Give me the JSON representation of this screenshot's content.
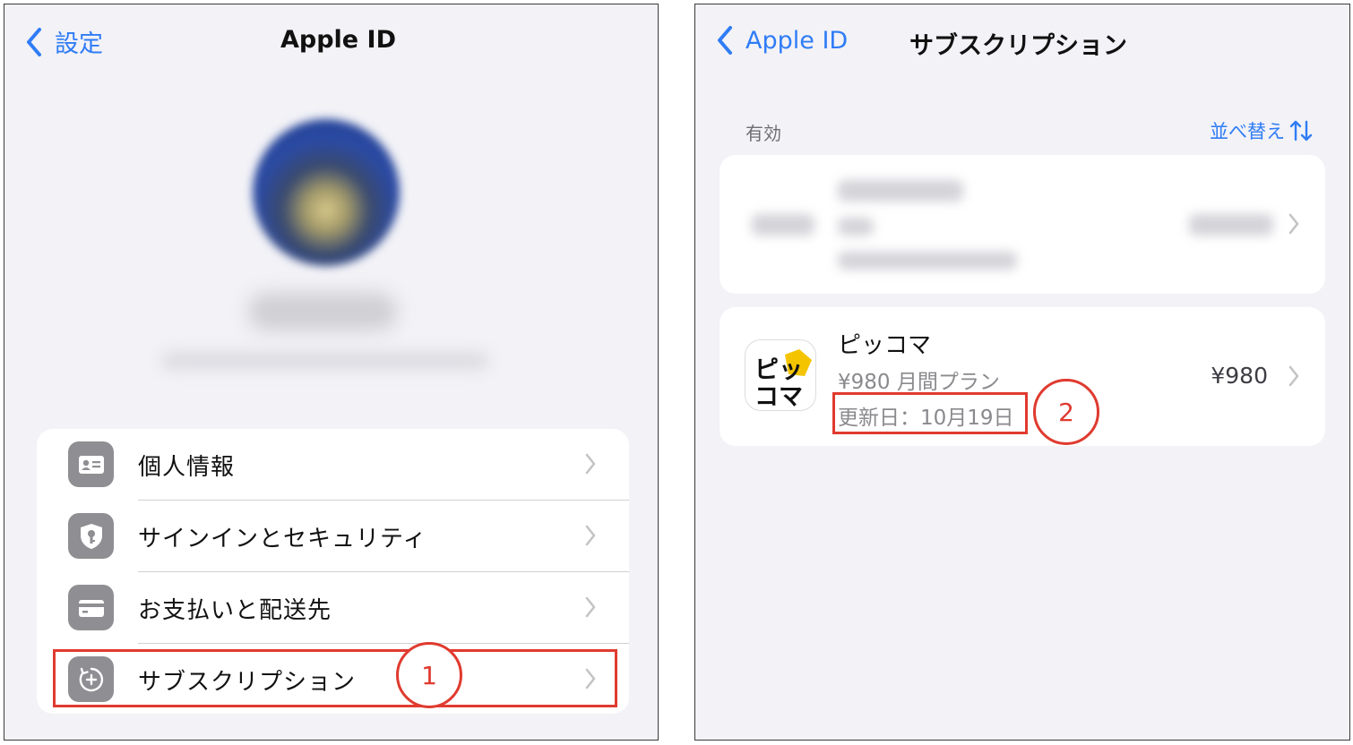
{
  "left": {
    "back_label": "設定",
    "title": "Apple ID",
    "menu": [
      {
        "label": "個人情報",
        "icon": "contact-card-icon"
      },
      {
        "label": "サインインとセキュリティ",
        "icon": "shield-key-icon"
      },
      {
        "label": "お支払いと配送先",
        "icon": "credit-card-icon"
      },
      {
        "label": "サブスクリプション",
        "icon": "subscription-plus-icon"
      }
    ],
    "callout": "1"
  },
  "right": {
    "back_label": "Apple ID",
    "title": "サブスクリプション",
    "section_header": "有効",
    "sort_label": "並べ替え",
    "subscription": {
      "name": "ピッコマ",
      "plan": "¥980 月間プラン",
      "renewal": "更新日：10月19日",
      "price": "¥980",
      "icon_text_top": "ピッ",
      "icon_text_bottom": "コマ"
    },
    "callout": "2"
  },
  "colors": {
    "accent": "#2f7cf6",
    "highlight": "#e03a2f",
    "icon_gray": "#8e8e93",
    "background": "#f2f2f7"
  }
}
